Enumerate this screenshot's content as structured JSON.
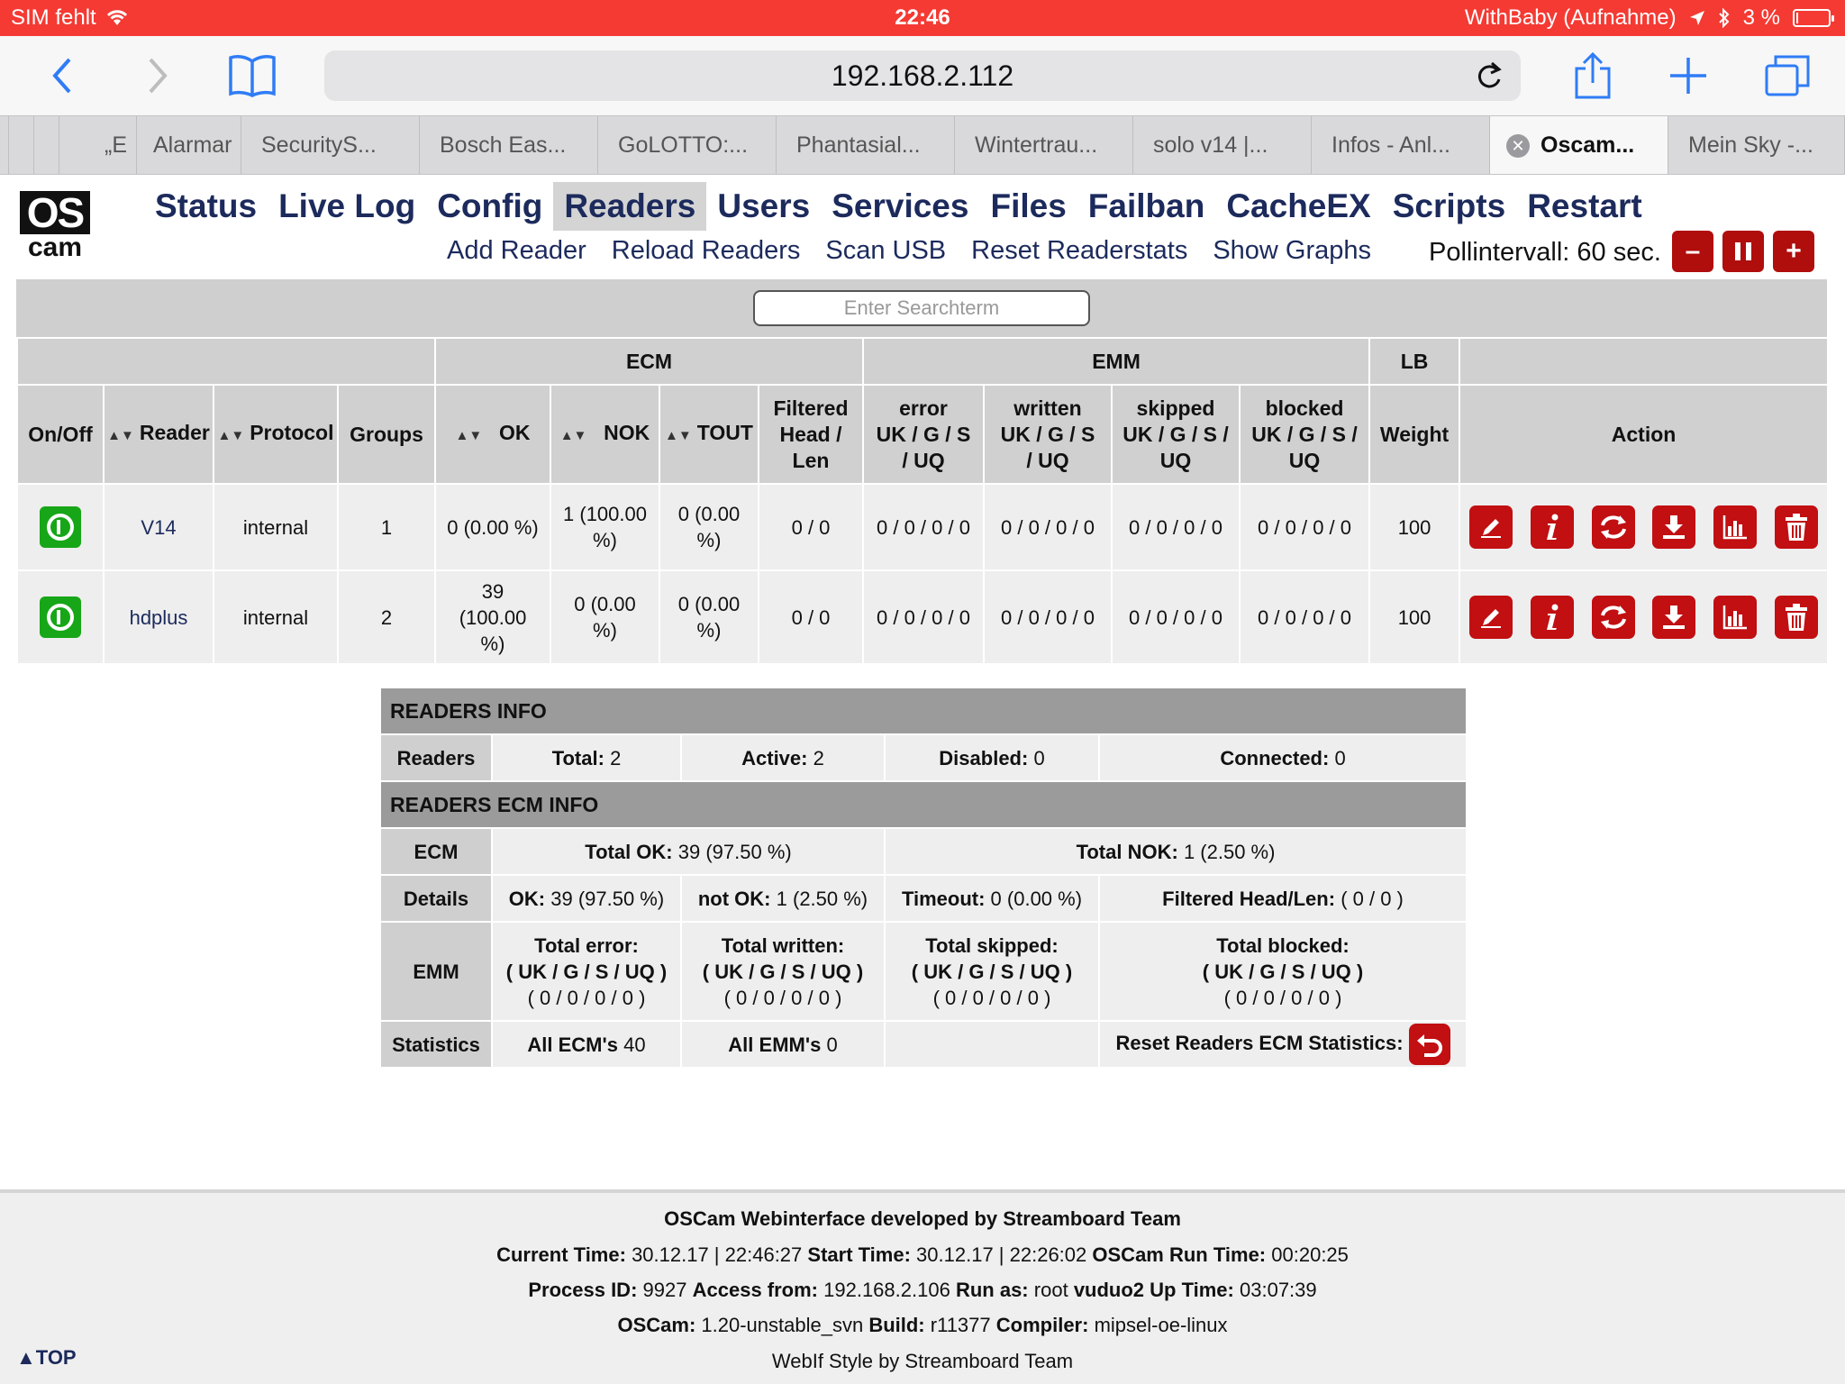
{
  "status_bar": {
    "carrier": "SIM fehlt",
    "time": "22:46",
    "recording": "WithBaby (Aufnahme)",
    "battery": "3 %"
  },
  "browser": {
    "url": "192.168.2.112",
    "tabs": [
      "„E",
      "Alarmar",
      "SecurityS...",
      "Bosch Eas...",
      "GoLOTTO:...",
      "Phantasial...",
      "Wintertrau...",
      "solo v14 |...",
      "Infos - Anl...",
      "Oscam...",
      "Mein Sky -..."
    ]
  },
  "logo": {
    "top": "OS",
    "bottom": "cam"
  },
  "menu": [
    "Status",
    "Live Log",
    "Config",
    "Readers",
    "Users",
    "Services",
    "Files",
    "Failban",
    "CacheEX",
    "Scripts",
    "Restart"
  ],
  "submenu": [
    "Add Reader",
    "Reload Readers",
    "Scan USB",
    "Reset Readerstats",
    "Show Graphs"
  ],
  "poll": {
    "label": "Pollintervall: 60 sec.",
    "minus": "–",
    "plus": "+"
  },
  "search": {
    "placeholder": "Enter Searchterm"
  },
  "readers_table": {
    "groups": {
      "ecm": "ECM",
      "emm": "EMM",
      "lb": "LB"
    },
    "headers": {
      "onoff": "On/Off",
      "reader": "Reader",
      "protocol": "Protocol",
      "groups": "Groups",
      "ok": "OK",
      "nok": "NOK",
      "tout": "TOUT",
      "filtered_1": "Filtered",
      "filtered_2": "Head /",
      "filtered_3": "Len",
      "error_1": "error",
      "error_2": "UK / G / S",
      "error_3": "/ UQ",
      "written_1": "written",
      "written_2": "UK / G / S",
      "written_3": "/ UQ",
      "skipped_1": "skipped",
      "skipped_2": "UK / G / S /",
      "skipped_3": "UQ",
      "blocked_1": "blocked",
      "blocked_2": "UK / G / S /",
      "blocked_3": "UQ",
      "weight": "Weight",
      "action": "Action"
    },
    "rows": [
      {
        "reader": "V14",
        "protocol": "internal",
        "groups": "1",
        "ok_1": "0 (0.00 %)",
        "ok_2": "",
        "ok_3": "",
        "nok_1": "1 (100.00",
        "nok_2": "%)",
        "tout_1": "0 (0.00",
        "tout_2": "%)",
        "filtered": "0 / 0",
        "error": "0 / 0 / 0 / 0",
        "written": "0 / 0 / 0 / 0",
        "skipped": "0 / 0 / 0 / 0",
        "blocked": "0 / 0 / 0 / 0",
        "weight": "100"
      },
      {
        "reader": "hdplus",
        "protocol": "internal",
        "groups": "2",
        "ok_1": "39",
        "ok_2": "(100.00",
        "ok_3": "%)",
        "nok_1": "0 (0.00",
        "nok_2": "%)",
        "tout_1": "0 (0.00",
        "tout_2": "%)",
        "filtered": "0 / 0",
        "error": "0 / 0 / 0 / 0",
        "written": "0 / 0 / 0 / 0",
        "skipped": "0 / 0 / 0 / 0",
        "blocked": "0 / 0 / 0 / 0",
        "weight": "100"
      }
    ],
    "action_icons": [
      "edit-icon",
      "info-icon",
      "refresh-icon",
      "download-icon",
      "graph-icon",
      "delete-icon"
    ]
  },
  "readers_info": {
    "title": "READERS INFO",
    "readers_label": "Readers",
    "total_label": "Total:",
    "total": "2",
    "active_label": "Active:",
    "active": "2",
    "disabled_label": "Disabled:",
    "disabled": "0",
    "connected_label": "Connected:",
    "connected": "0"
  },
  "ecm_info": {
    "title": "READERS ECM INFO",
    "ecm_label": "ECM",
    "total_ok_label": "Total OK:",
    "total_ok": "39 (97.50 %)",
    "total_nok_label": "Total NOK:",
    "total_nok": "1 (2.50 %)",
    "details_label": "Details",
    "ok_label": "OK:",
    "ok": "39 (97.50 %)",
    "notok_label": "not OK:",
    "notok": "1 (2.50 %)",
    "timeout_label": "Timeout:",
    "timeout": "0 (0.00 %)",
    "filtered_label": "Filtered Head/Len:",
    "filtered": "( 0 / 0 )",
    "emm_label": "EMM",
    "emm_fields": "( UK / G / S / UQ )",
    "emm_values": "( 0 / 0 / 0 / 0 )",
    "total_error": "Total error:",
    "total_written": "Total written:",
    "total_skipped": "Total skipped:",
    "total_blocked": "Total blocked:",
    "statistics_label": "Statistics",
    "all_ecm_label": "All ECM's",
    "all_ecm": "40",
    "all_emm_label": "All EMM's",
    "all_emm": "0",
    "reset_label": "Reset Readers ECM Statistics:"
  },
  "footer": {
    "line1": "OSCam Webinterface developed by Streamboard Team",
    "current_time_label": "Current Time:",
    "current_time": "30.12.17 | 22:46:27",
    "start_time_label": "Start Time:",
    "start_time": "30.12.17 | 22:26:02",
    "run_time_label": "OSCam Run Time:",
    "run_time": "00:20:25",
    "pid_label": "Process ID:",
    "pid": "9927",
    "access_label": "Access from:",
    "access": "192.168.2.106",
    "runas_label": "Run as:",
    "runas": "root",
    "uptime_label": "vuduo2 Up Time:",
    "uptime": "03:07:39",
    "oscam_label": "OSCam:",
    "oscam": "1.20-unstable_svn",
    "build_label": "Build:",
    "build": "r11377",
    "compiler_label": "Compiler:",
    "compiler": "mipsel-oe-linux",
    "style": "WebIf Style by Streamboard Team",
    "top": "▲TOP"
  }
}
